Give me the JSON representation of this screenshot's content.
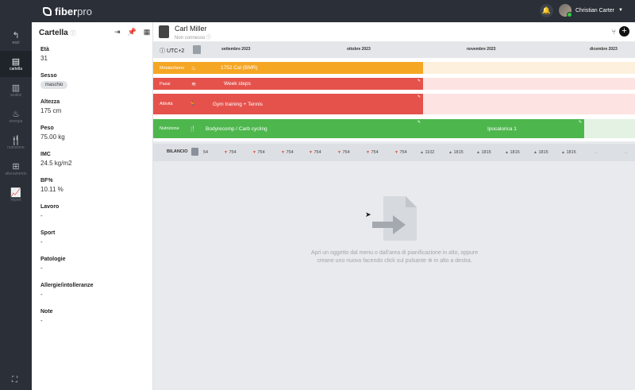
{
  "app": {
    "brand_main": "fiber",
    "brand_sub": "pro"
  },
  "user": {
    "name": "Christian Carter"
  },
  "nav": [
    {
      "label": "esci",
      "icon": "back-arrow-icon"
    },
    {
      "label": "cartella",
      "icon": "clipboard-icon"
    },
    {
      "label": "analisi",
      "icon": "chart-doc-icon"
    },
    {
      "label": "energia",
      "icon": "flame-icon"
    },
    {
      "label": "nutrizione",
      "icon": "fork-knife-icon"
    },
    {
      "label": "allenamento",
      "icon": "dumbbell-icon"
    },
    {
      "label": "report",
      "icon": "trend-chart-icon"
    }
  ],
  "panel": {
    "title": "Cartella",
    "fields": [
      {
        "label": "Età",
        "value": "31"
      },
      {
        "label": "Sesso",
        "value": "maschio"
      },
      {
        "label": "Altezza",
        "value": "175 cm"
      },
      {
        "label": "Peso",
        "value": "75.00 kg"
      },
      {
        "label": "IMC",
        "value": "24.5 kg/m2"
      },
      {
        "label": "BF%",
        "value": "10.11 %"
      },
      {
        "label": "Lavoro",
        "value": "-"
      },
      {
        "label": "Sport",
        "value": "-"
      },
      {
        "label": "Patologie",
        "value": "-"
      },
      {
        "label": "Allergie/intolleranze",
        "value": "-"
      },
      {
        "label": "Note",
        "value": "-"
      }
    ]
  },
  "patient": {
    "name": "Carl Miller",
    "status": "Non connesso"
  },
  "timeline": {
    "timezone": "UTC+2",
    "months": [
      "settembre 2023",
      "ottobre 2023",
      "novembre 2023",
      "dicembre 2023"
    ],
    "rows": [
      {
        "label": "Metabolismo",
        "bar": "1752 Cal (BMR)",
        "color": "#f5a623"
      },
      {
        "label": "Passi",
        "bar": "Week steps",
        "color": "#e5524c"
      },
      {
        "label": "Attività",
        "bar": "Gym training + Tennis",
        "color": "#e5524c"
      },
      {
        "label": "Nutrizione",
        "bar": "Bodyrecomp / Carb cycling",
        "bar2": "Ipocalorica 1",
        "color": "#4db74d"
      }
    ],
    "balance_label": "BILANCIO",
    "balance": [
      "54",
      "754",
      "754",
      "754",
      "754",
      "754",
      "754",
      "754",
      "1102",
      "1815",
      "1815",
      "1815",
      "1815",
      "1815",
      "...",
      "..."
    ]
  },
  "empty_state": {
    "line1": "Apri un oggetto dal menu o dall'area di pianificazione in alto, oppure",
    "line2": "creane uno nuovo facendo click sul pulsante ⊕ in alto a destra."
  }
}
